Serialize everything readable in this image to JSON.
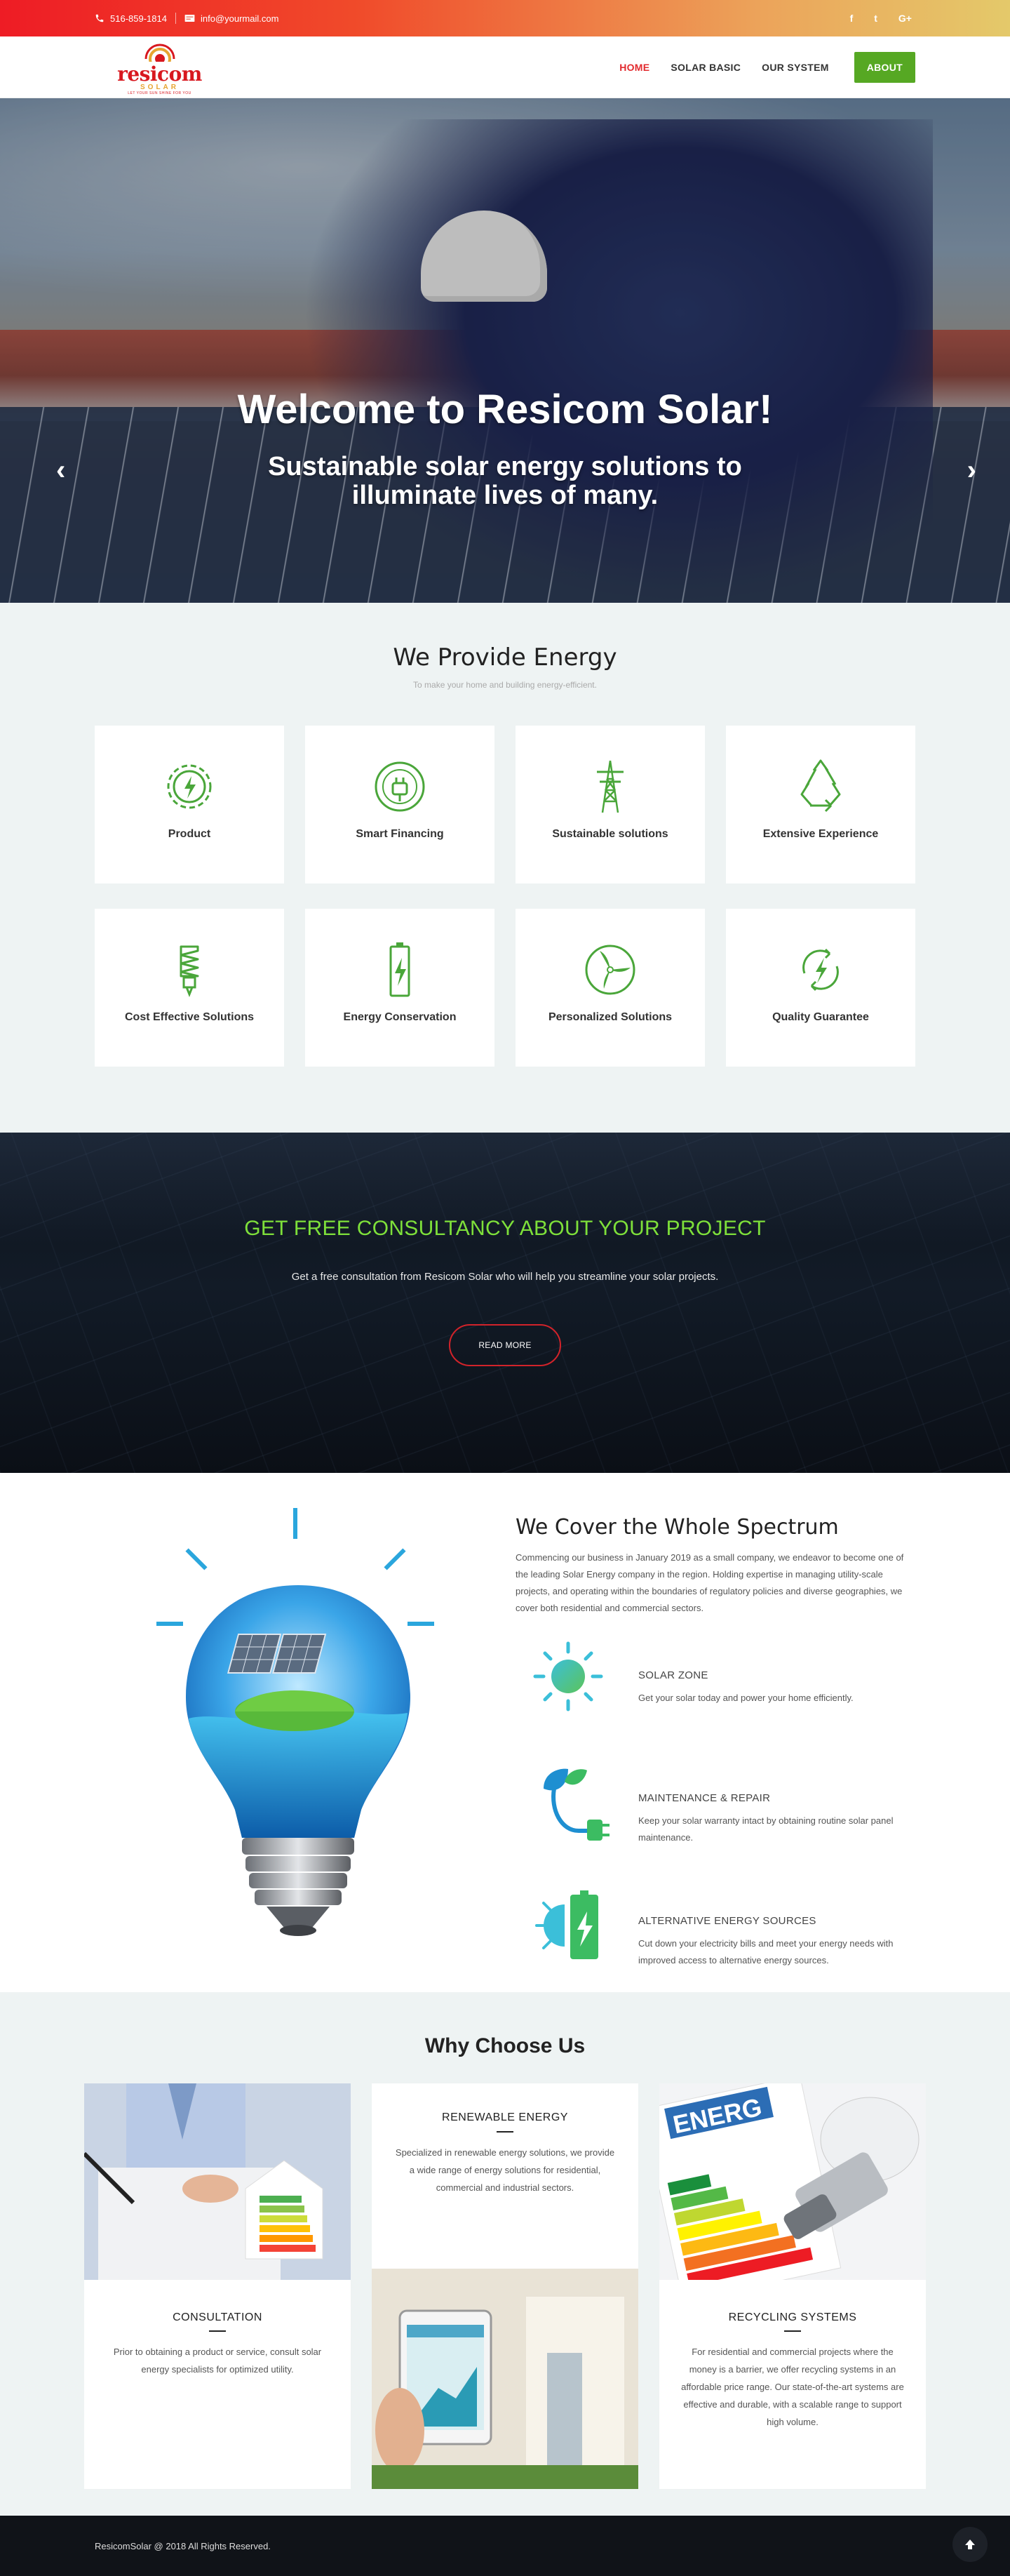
{
  "topbar": {
    "phone": "516-859-1814",
    "email": "info@yourmail.com",
    "social": [
      "f",
      "t",
      "G+"
    ]
  },
  "logo": {
    "word": "resicom",
    "sub": "SOLAR",
    "tagline": "LET YOUR SUN SHINE FOR YOU"
  },
  "nav": {
    "items": [
      "HOME",
      "SOLAR BASIC",
      "OUR SYSTEM"
    ],
    "about": "ABOUT"
  },
  "hero": {
    "title": "Welcome to Resicom Solar!",
    "subtitle": "Sustainable solar energy solutions to illuminate lives of many.",
    "prev": "‹",
    "next": "›"
  },
  "provide": {
    "title": "We Provide Energy",
    "subtitle": "To make your home and building energy-efficient.",
    "cards": [
      {
        "label": "Product",
        "icon": "gear-bolt-icon"
      },
      {
        "label": "Smart Financing",
        "icon": "plug-icon"
      },
      {
        "label": "Sustainable solutions",
        "icon": "power-tower-icon"
      },
      {
        "label": "Extensive Experience",
        "icon": "recycle-icon"
      },
      {
        "label": "Cost Effective Solutions",
        "icon": "energy-bulb-icon"
      },
      {
        "label": "Energy Conservation",
        "icon": "battery-icon"
      },
      {
        "label": "Personalized Solutions",
        "icon": "wind-turbine-icon"
      },
      {
        "label": "Quality Guarantee",
        "icon": "renewable-bolt-icon"
      }
    ]
  },
  "consult": {
    "title": "GET FREE CONSULTANCY ABOUT YOUR PROJECT",
    "text": "Get a free consultation from Resicom Solar who will help you streamline your solar projects.",
    "button": "READ MORE"
  },
  "spectrum": {
    "title": "We Cover the Whole Spectrum",
    "intro": "Commencing our business in January 2019 as a small company, we endeavor to become one of the leading Solar Energy company in the region. Holding expertise in managing utility-scale projects, and operating within the boundaries of regulatory policies and diverse geographies, we cover both residential and commercial sectors.",
    "features": [
      {
        "title": "SOLAR ZONE",
        "desc": "Get your solar today and power your home efficiently."
      },
      {
        "title": "MAINTENANCE & REPAIR",
        "desc": "Keep your solar warranty intact by obtaining routine solar panel maintenance."
      },
      {
        "title": "ALTERNATIVE ENERGY SOURCES",
        "desc": "Cut down your electricity bills and meet your energy needs with improved access to alternative energy sources."
      }
    ]
  },
  "why": {
    "title": "Why Choose Us",
    "columns": [
      {
        "title": "CONSULTATION",
        "desc": "Prior to obtaining a product or service, consult solar energy specialists for optimized utility."
      },
      {
        "title": "RENEWABLE ENERGY",
        "desc": "Specialized in renewable energy solutions, we provide a wide range of energy solutions for residential, commercial and industrial sectors."
      },
      {
        "title": "RECYCLING SYSTEMS",
        "desc": "For residential and commercial projects where the money is a barrier, we offer recycling systems in an affordable price range. Our state-of-the-art systems are effective and durable, with a scalable range to support high volume."
      }
    ],
    "energy_label_text": "ENERG"
  },
  "footer": {
    "copy": "ResicomSolar @ 2018 All Rights Reserved."
  },
  "colors": {
    "accent_green": "#56a823",
    "accent_red": "#e22a2e",
    "consult_title": "#7ee03a"
  }
}
